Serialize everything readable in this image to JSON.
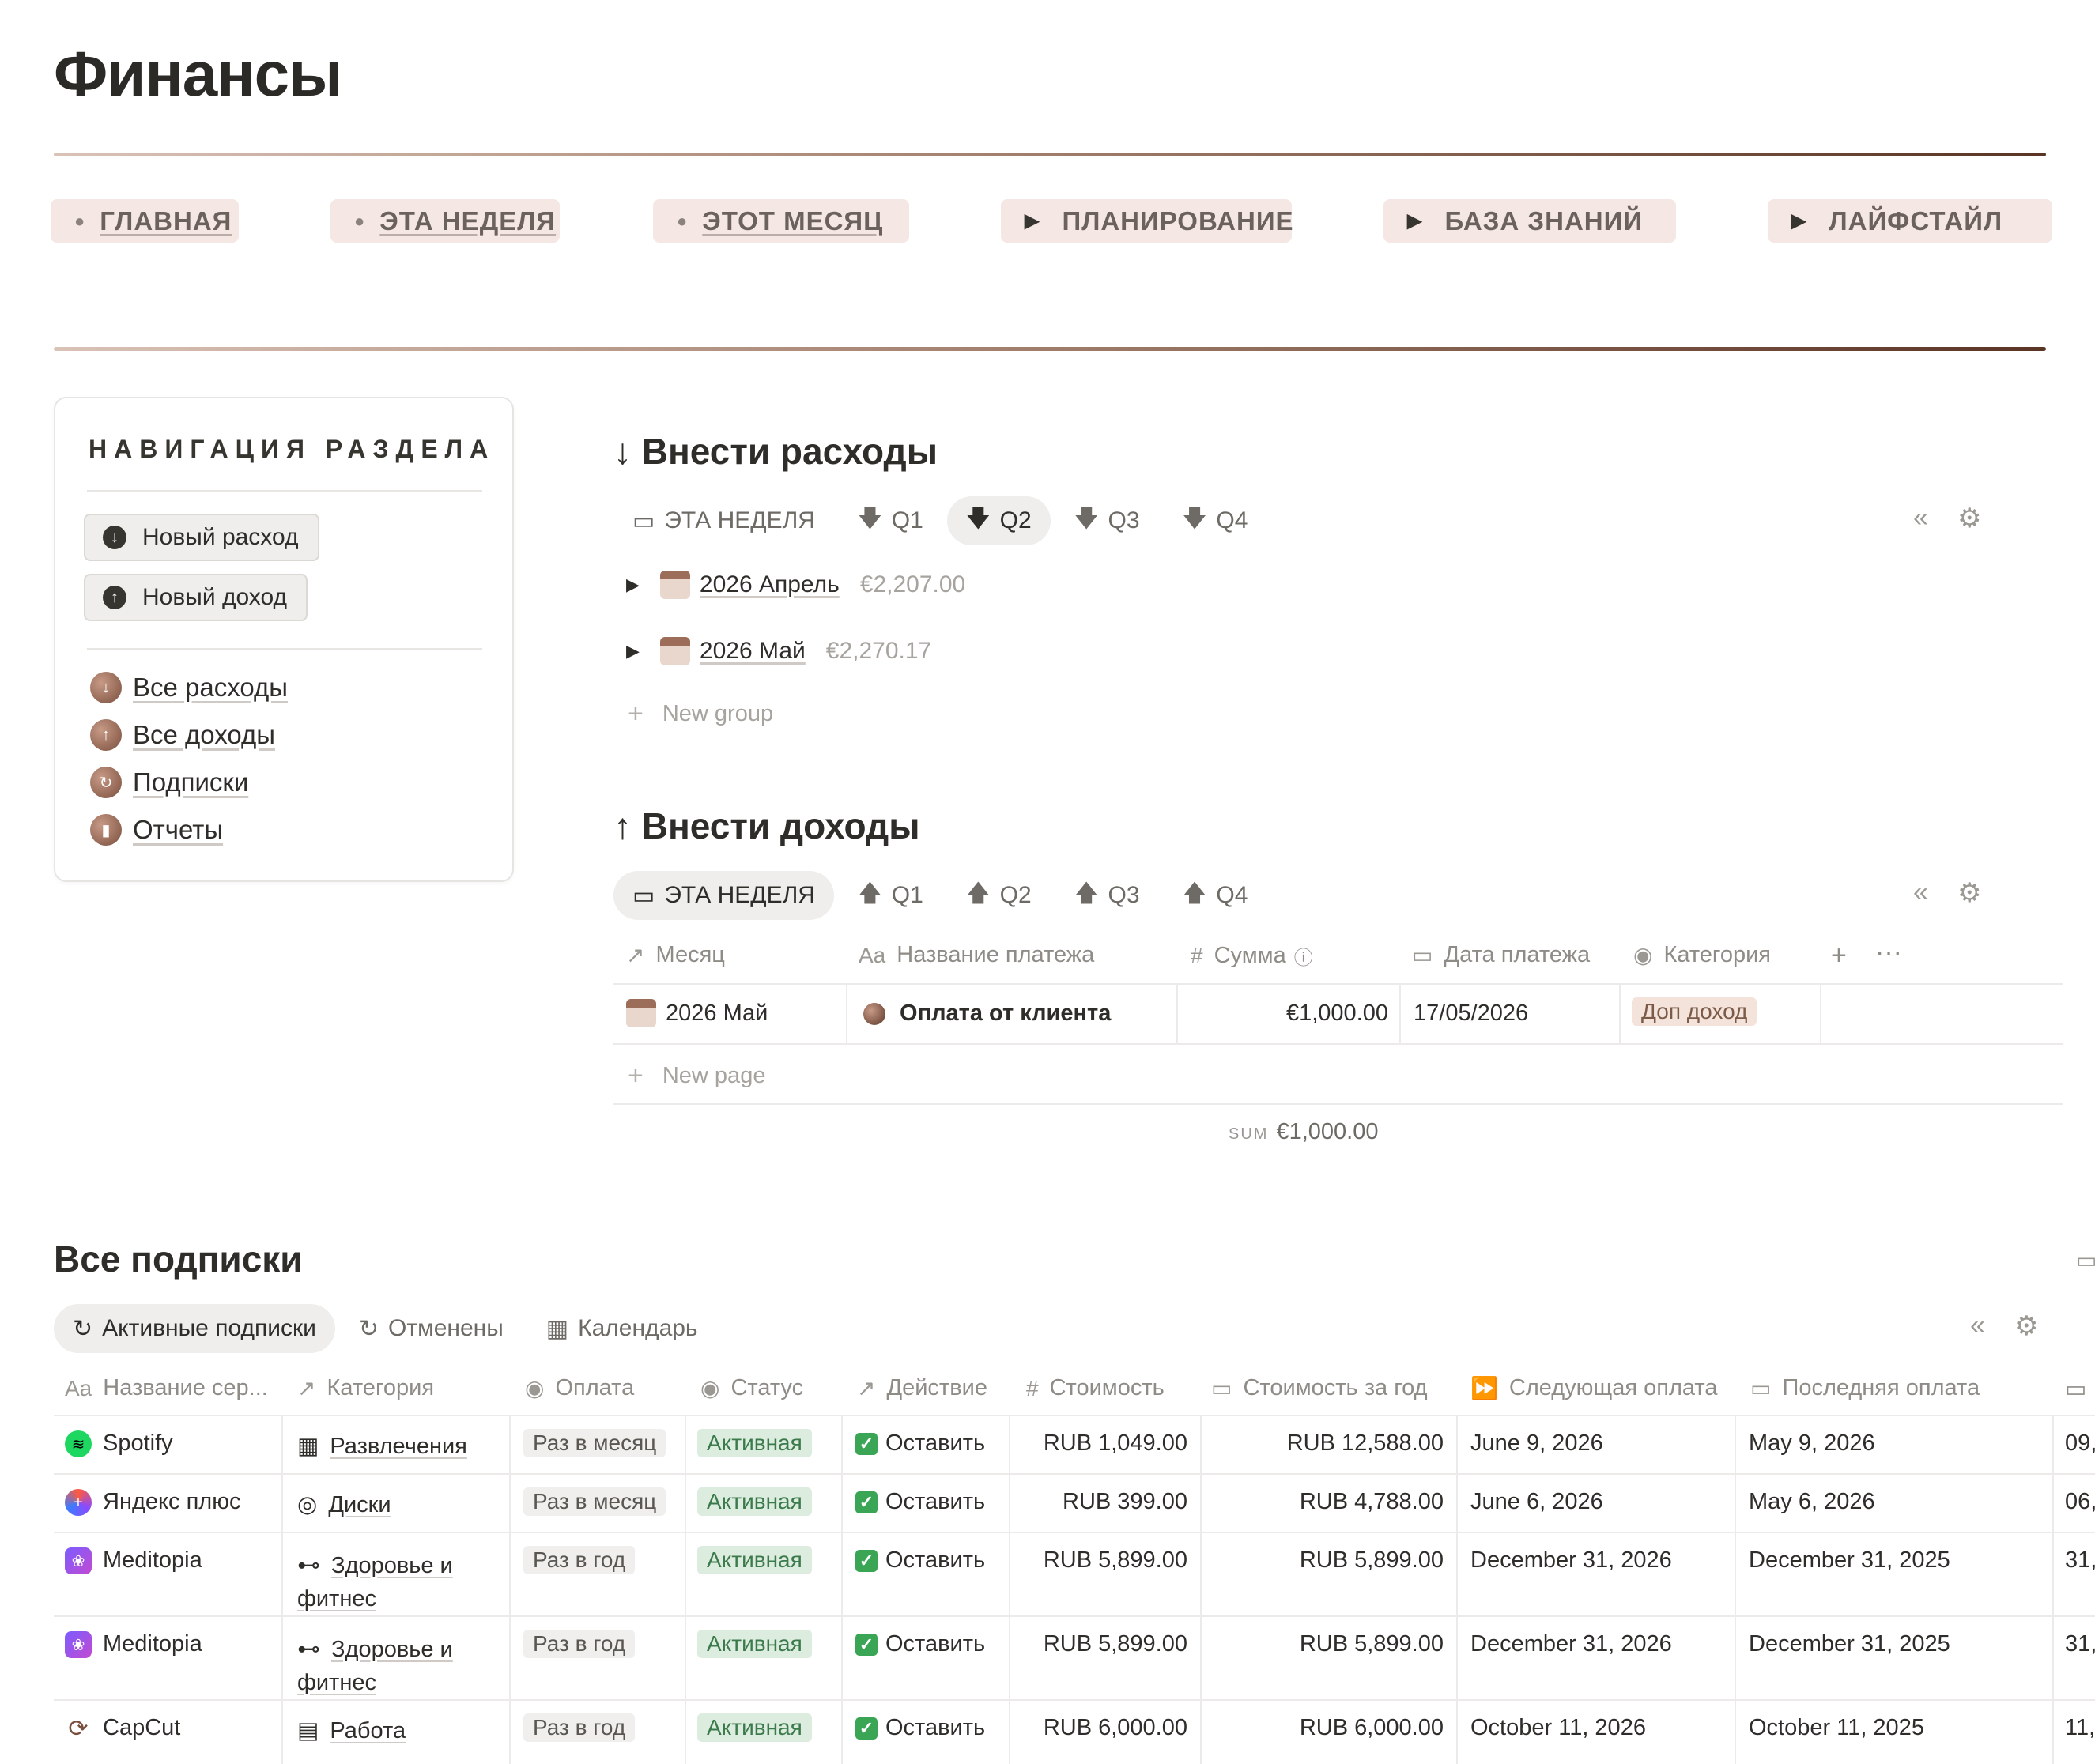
{
  "page": {
    "title": "Финансы"
  },
  "topnav": [
    {
      "label": "ГЛАВНАЯ",
      "kind": "link"
    },
    {
      "label": "ЭТА НЕДЕЛЯ",
      "kind": "link"
    },
    {
      "label": "ЭТОТ МЕСЯЦ",
      "kind": "link"
    },
    {
      "label": "ПЛАНИРОВАНИЕ",
      "kind": "toggle"
    },
    {
      "label": "БАЗА ЗНАНИЙ",
      "kind": "toggle"
    },
    {
      "label": "ЛАЙФСТАЙЛ",
      "kind": "toggle"
    }
  ],
  "section_nav": {
    "title": "НАВИГАЦИЯ РАЗДЕЛА",
    "buttons": [
      {
        "label": "Новый расход",
        "icon": "arrow-down-circle-icon"
      },
      {
        "label": "Новый доход",
        "icon": "arrow-up-circle-icon"
      }
    ],
    "links": [
      {
        "label": "Все расходы",
        "icon": "arrow-down-icon"
      },
      {
        "label": "Все доходы",
        "icon": "arrow-up-icon"
      },
      {
        "label": "Подписки",
        "icon": "refresh-icon"
      },
      {
        "label": "Отчеты",
        "icon": "bar-chart-icon"
      }
    ]
  },
  "expenses": {
    "title": "Внести расходы",
    "tabs": [
      "ЭТА НЕДЕЛЯ",
      "Q1",
      "Q2",
      "Q3",
      "Q4"
    ],
    "active_tab": "Q2",
    "groups": [
      {
        "label": "2026 Апрель",
        "amount": "€2,207.00"
      },
      {
        "label": "2026 Май",
        "amount": "€2,270.17"
      }
    ],
    "new_group": "New group"
  },
  "income": {
    "title": "Внести доходы",
    "tabs": [
      "ЭТА НЕДЕЛЯ",
      "Q1",
      "Q2",
      "Q3",
      "Q4"
    ],
    "active_tab": "ЭТА НЕДЕЛЯ",
    "columns": [
      "Месяц",
      "Название платежа",
      "Сумма",
      "Дата платежа",
      "Категория"
    ],
    "row": {
      "month": "2026 Май",
      "name": "Оплата от клиента",
      "amount": "€1,000.00",
      "date": "17/05/2026",
      "category": "Доп доход"
    },
    "new_page": "New page",
    "sum_label": "SUM",
    "sum_value": "€1,000.00"
  },
  "subscriptions": {
    "title": "Все подписки",
    "tabs": [
      "Активные подписки",
      "Отменены",
      "Календарь"
    ],
    "active_tab": "Активные подписки",
    "columns": [
      "Название сер...",
      "Категория",
      "Оплата",
      "Статус",
      "Действие",
      "Стоимость",
      "Стоимость за год",
      "Следующая оплата",
      "Последняя оплата"
    ],
    "rows": [
      {
        "name": "Spotify",
        "icon": "spotify-icon",
        "category": "Развлечения",
        "cat_icon": "film-icon",
        "category_line2": "",
        "payment": "Раз в месяц",
        "status": "Активная",
        "action": "Оставить",
        "cost": "RUB 1,049.00",
        "cost_year": "RUB 12,588.00",
        "next": "June 9, 2026",
        "last": "May 9, 2026",
        "extra": "09,"
      },
      {
        "name": "Яндекс плюс",
        "icon": "yandex-plus-icon",
        "category": "Диски",
        "cat_icon": "disc-icon",
        "category_line2": "",
        "payment": "Раз в месяц",
        "status": "Активная",
        "action": "Оставить",
        "cost": "RUB 399.00",
        "cost_year": "RUB 4,788.00",
        "next": "June 6, 2026",
        "last": "May 6, 2026",
        "extra": "06,"
      },
      {
        "name": "Meditopia",
        "icon": "meditopia-icon",
        "category": "Здоровье и",
        "cat_icon": "dumbbell-icon",
        "category_line2": "фитнес",
        "payment": "Раз в год",
        "status": "Активная",
        "action": "Оставить",
        "cost": "RUB 5,899.00",
        "cost_year": "RUB 5,899.00",
        "next": "December 31, 2026",
        "last": "December 31, 2025",
        "extra": "31,"
      },
      {
        "name": "Meditopia",
        "icon": "meditopia-icon",
        "category": "Здоровье и",
        "cat_icon": "dumbbell-icon",
        "category_line2": "фитнес",
        "payment": "Раз в год",
        "status": "Активная",
        "action": "Оставить",
        "cost": "RUB 5,899.00",
        "cost_year": "RUB 5,899.00",
        "next": "December 31, 2026",
        "last": "December 31, 2025",
        "extra": "31,"
      },
      {
        "name": "CapCut",
        "icon": "capcut-icon",
        "category": "Работа",
        "cat_icon": "briefcase-icon",
        "category_line2": "",
        "payment": "Раз в год",
        "status": "Активная",
        "action": "Оставить",
        "cost": "RUB 6,000.00",
        "cost_year": "RUB 6,000.00",
        "next": "October 11, 2026",
        "last": "October 11, 2025",
        "extra": "11,"
      }
    ]
  }
}
